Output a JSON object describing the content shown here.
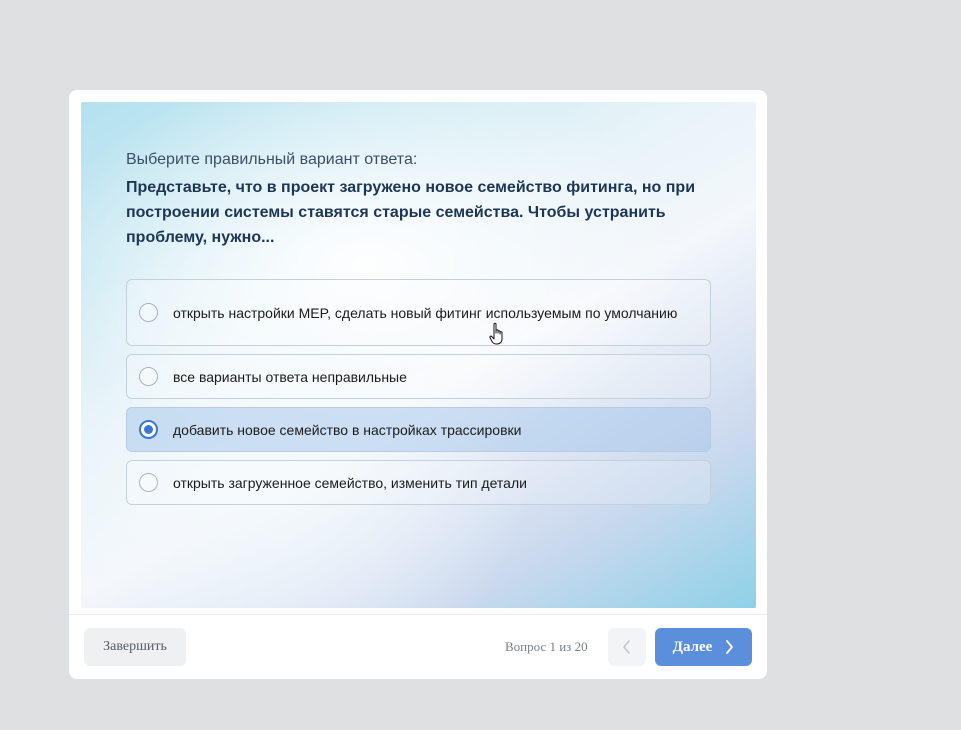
{
  "quiz": {
    "prompt": "Выберите правильный вариант ответа:",
    "question": "Представьте, что в проект загружено новое семейство фитинга, но при построении системы ставятся старые семейства. Чтобы устранить проблему, нужно...",
    "options": [
      {
        "label": "открыть настройки MEP, сделать новый фитинг используемым по умолчанию",
        "selected": false
      },
      {
        "label": "все варианты ответа неправильные",
        "selected": false
      },
      {
        "label": "добавить новое семейство в настройках трассировки",
        "selected": true
      },
      {
        "label": "открыть загруженное семейство, изменить тип детали",
        "selected": false
      }
    ]
  },
  "footer": {
    "finish_label": "Завершить",
    "counter": "Вопрос 1 из 20",
    "prev_icon": "chevron-left-icon",
    "next_label": "Далее",
    "next_icon": "chevron-right-icon"
  },
  "colors": {
    "accent": "#5b8fdb",
    "radio_checked": "#3b77d0",
    "question_text": "#1c3654",
    "page_background": "#dfe0e2"
  }
}
